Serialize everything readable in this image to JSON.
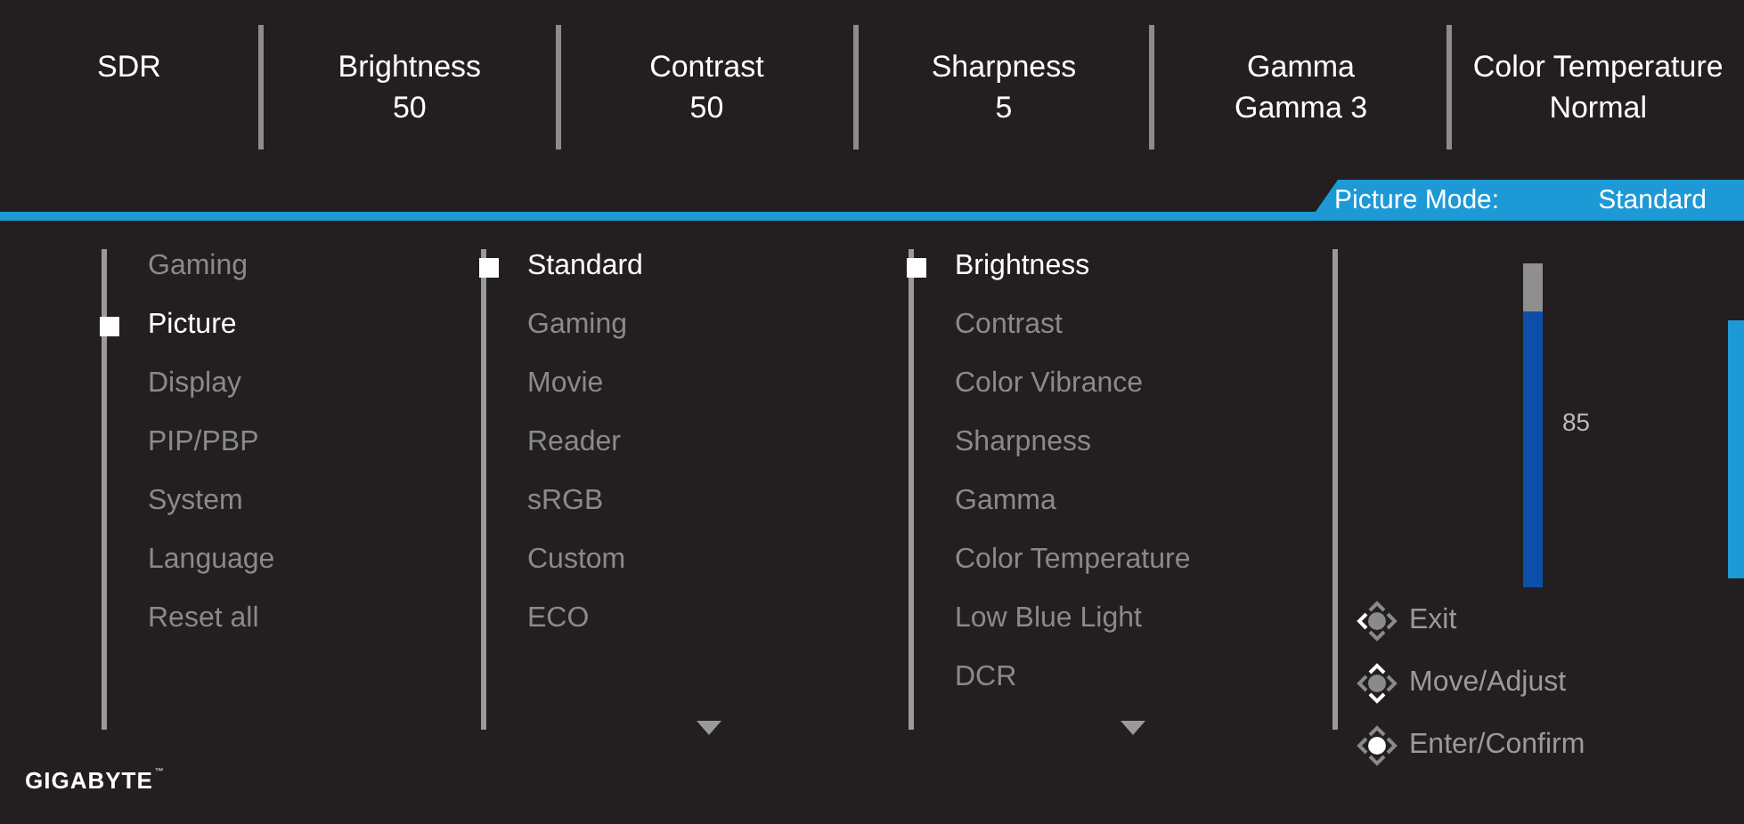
{
  "top_bar": [
    {
      "label": "SDR"
    },
    {
      "label": "Brightness",
      "value": "50"
    },
    {
      "label": "Contrast",
      "value": "50"
    },
    {
      "label": "Sharpness",
      "value": "5"
    },
    {
      "label": "Gamma",
      "value": "Gamma 3"
    },
    {
      "label": "Color Temperature",
      "value": "Normal"
    }
  ],
  "mode_tab": {
    "label": "Picture Mode:",
    "value": "Standard"
  },
  "columns": [
    {
      "items": [
        {
          "label": "Gaming",
          "selected": false
        },
        {
          "label": "Picture",
          "selected": true
        },
        {
          "label": "Display",
          "selected": false
        },
        {
          "label": "PIP/PBP",
          "selected": false
        },
        {
          "label": "System",
          "selected": false
        },
        {
          "label": "Language",
          "selected": false
        },
        {
          "label": "Reset all",
          "selected": false
        }
      ]
    },
    {
      "more_below": true,
      "items": [
        {
          "label": "Standard",
          "selected": true
        },
        {
          "label": "Gaming",
          "selected": false
        },
        {
          "label": "Movie",
          "selected": false
        },
        {
          "label": "Reader",
          "selected": false
        },
        {
          "label": "sRGB",
          "selected": false
        },
        {
          "label": "Custom",
          "selected": false
        },
        {
          "label": "ECO",
          "selected": false
        }
      ]
    },
    {
      "more_below": true,
      "items": [
        {
          "label": "Brightness",
          "selected": true
        },
        {
          "label": "Contrast",
          "selected": false
        },
        {
          "label": "Color Vibrance",
          "selected": false
        },
        {
          "label": "Sharpness",
          "selected": false
        },
        {
          "label": "Gamma",
          "selected": false
        },
        {
          "label": "Color Temperature",
          "selected": false
        },
        {
          "label": "Low Blue Light",
          "selected": false
        },
        {
          "label": "DCR",
          "selected": false
        }
      ]
    }
  ],
  "slider": {
    "level": 0.85,
    "reading": "85"
  },
  "hints": [
    {
      "kind": "exit",
      "label": "Exit"
    },
    {
      "kind": "move",
      "label": "Move/Adjust"
    },
    {
      "kind": "enter",
      "label": "Enter/Confirm"
    }
  ],
  "logo": "GIGABYTE",
  "logo_mark": "™"
}
